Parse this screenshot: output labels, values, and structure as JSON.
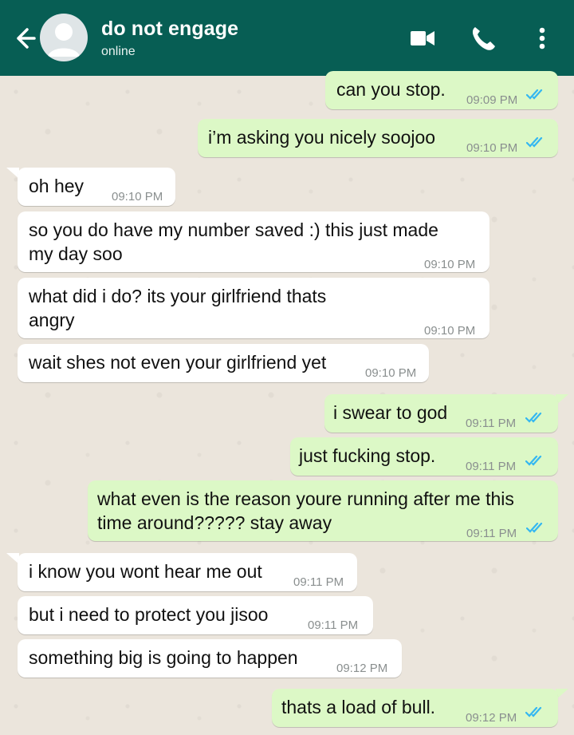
{
  "header": {
    "title": "do not engage",
    "status": "online"
  },
  "colors": {
    "header": "#075e54",
    "incoming": "#ffffff",
    "outgoing": "#dcf8c6",
    "read_ticks": "#34b7f1"
  },
  "messages": [
    {
      "dir": "out",
      "text": "can you stop.",
      "time": "09:09 PM"
    },
    {
      "dir": "out",
      "text": "i’m asking you nicely soojoo",
      "time": "09:10 PM"
    },
    {
      "dir": "in",
      "text": "oh hey",
      "time": "09:10 PM"
    },
    {
      "dir": "in",
      "lines": [
        "so you do have my number saved :) this just made",
        "my day soo"
      ],
      "time": "09:10 PM"
    },
    {
      "dir": "in",
      "lines": [
        "what did i do? its your girlfriend thats",
        "angry"
      ],
      "time": "09:10 PM"
    },
    {
      "dir": "in",
      "text": "wait shes not even your girlfriend yet",
      "time": "09:10 PM"
    },
    {
      "dir": "out",
      "text": "i swear to god",
      "time": "09:11 PM"
    },
    {
      "dir": "out",
      "text": "just fucking stop.",
      "time": "09:11 PM"
    },
    {
      "dir": "out",
      "lines": [
        "what even is the reason youre running after me this",
        "time around????? stay away"
      ],
      "time": "09:11 PM"
    },
    {
      "dir": "in",
      "text": "i know you wont hear me out",
      "time": "09:11 PM"
    },
    {
      "dir": "in",
      "text": "but i need to protect you jisoo",
      "time": "09:11 PM"
    },
    {
      "dir": "in",
      "text": "something big is going to happen",
      "time": "09:12 PM"
    },
    {
      "dir": "out",
      "text": "thats a load of bull.",
      "time": "09:12 PM"
    }
  ]
}
